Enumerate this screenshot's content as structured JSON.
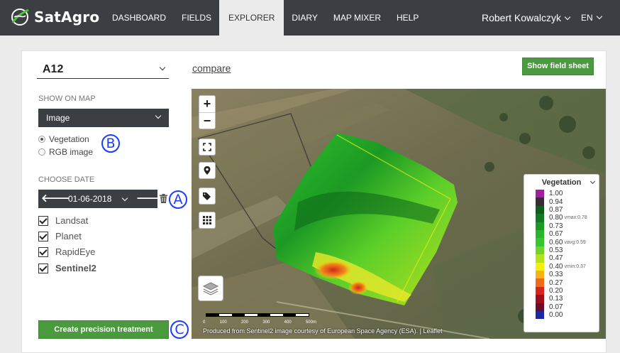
{
  "brand": {
    "name": "SatAgro"
  },
  "nav": [
    {
      "label": "Dashboard",
      "active": false
    },
    {
      "label": "Fields",
      "active": false
    },
    {
      "label": "Explorer",
      "active": true
    },
    {
      "label": "Diary",
      "active": false
    },
    {
      "label": "Map Mixer",
      "active": false
    },
    {
      "label": "Help",
      "active": false
    }
  ],
  "user": {
    "name": "Robert Kowalczyk"
  },
  "lang": {
    "code": "EN"
  },
  "field": {
    "selected": "A12"
  },
  "compare_link": "compare",
  "show_field_sheet": "Show field sheet",
  "show_on_map": {
    "label": "Show on map",
    "select_value": "Image",
    "options": [
      {
        "label": "Vegetation",
        "checked": true
      },
      {
        "label": "RGB image",
        "checked": false
      }
    ]
  },
  "choose_date": {
    "label": "Choose date",
    "date": "01-06-2018",
    "prev": "🡐",
    "next": "🡒"
  },
  "sources": [
    {
      "label": "Landsat",
      "checked": true,
      "bold": false
    },
    {
      "label": "Planet",
      "checked": true,
      "bold": false
    },
    {
      "label": "RapidEye",
      "checked": true,
      "bold": false
    },
    {
      "label": "Sentinel2",
      "checked": true,
      "bold": true
    }
  ],
  "create_treatment": "Create precision treatment",
  "callouts": [
    "A",
    "B",
    "C"
  ],
  "map": {
    "zoom_in": "+",
    "zoom_out": "−",
    "scale_labels": [
      "0",
      "100",
      "200",
      "300",
      "400",
      "500m"
    ],
    "attribution": "Produced from Sentinel2 image courtesy of European Space Agency (ESA). | Leaflet"
  },
  "legend": {
    "title": "Vegetation",
    "items": [
      {
        "value": "1.00",
        "color": "#a020a0",
        "marker": ""
      },
      {
        "value": "0.94",
        "color": "#3a2a3a",
        "marker": ""
      },
      {
        "value": "0.87",
        "color": "#0f5e1c",
        "marker": ""
      },
      {
        "value": "0.80",
        "color": "#147a22",
        "marker": "vmax:0.78"
      },
      {
        "value": "0.73",
        "color": "#1a9a25",
        "marker": ""
      },
      {
        "value": "0.67",
        "color": "#2ab52a",
        "marker": ""
      },
      {
        "value": "0.60",
        "color": "#39c531",
        "marker": "vavg:0.59"
      },
      {
        "value": "0.53",
        "color": "#72d42a",
        "marker": ""
      },
      {
        "value": "0.47",
        "color": "#b4e21f",
        "marker": ""
      },
      {
        "value": "0.40",
        "color": "#f3ee12",
        "marker": "vmin:0.37"
      },
      {
        "value": "0.33",
        "color": "#f6b318",
        "marker": ""
      },
      {
        "value": "0.27",
        "color": "#ef6a1b",
        "marker": ""
      },
      {
        "value": "0.20",
        "color": "#d4261c",
        "marker": ""
      },
      {
        "value": "0.13",
        "color": "#a0101a",
        "marker": ""
      },
      {
        "value": "0.07",
        "color": "#6a0d2a",
        "marker": ""
      },
      {
        "value": "0.00",
        "color": "#1a2aa0",
        "marker": ""
      }
    ]
  }
}
